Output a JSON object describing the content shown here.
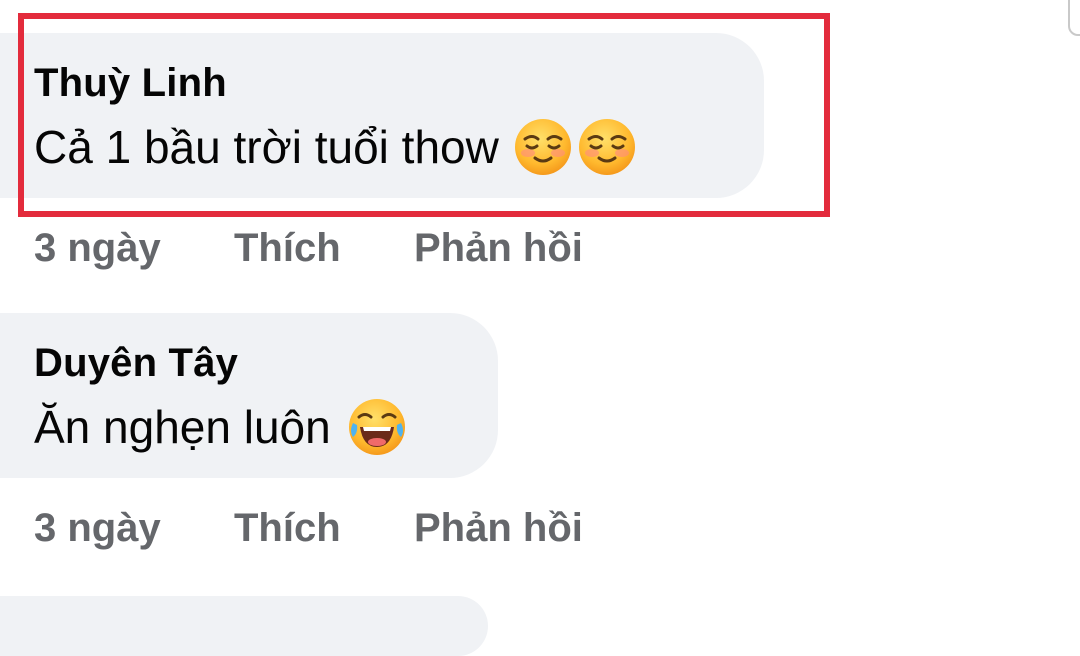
{
  "comments": [
    {
      "author": "Thuỳ Linh",
      "text": "Cả 1 bầu trời tuổi thow",
      "emojis": [
        "smiling-face-icon",
        "smiling-face-icon"
      ],
      "time": "3 ngày",
      "like_label": "Thích",
      "reply_label": "Phản hồi",
      "highlighted": true
    },
    {
      "author": "Duyên Tây",
      "text": "Ăn nghẹn luôn",
      "emojis": [
        "tears-of-joy-icon"
      ],
      "time": "3 ngày",
      "like_label": "Thích",
      "reply_label": "Phản hồi",
      "highlighted": false
    }
  ],
  "colors": {
    "bubble": "#f0f2f5",
    "text": "#050505",
    "meta": "#65676b",
    "highlight": "#e32b3c"
  }
}
